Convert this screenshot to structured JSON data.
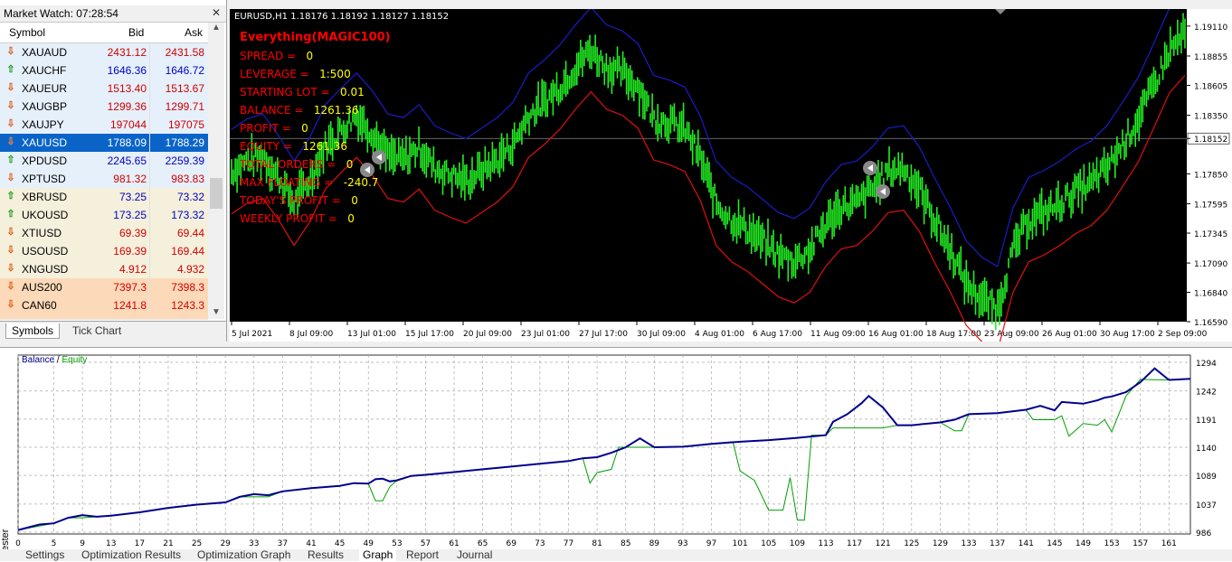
{
  "market_watch": {
    "title": "Market Watch: 07:28:54",
    "columns": {
      "symbol": "Symbol",
      "bid": "Bid",
      "ask": "Ask"
    },
    "rows": [
      {
        "symbol": "XAUAUD",
        "bid": "2431.12",
        "ask": "2431.58",
        "dir": "down",
        "color": "#d00000",
        "bg": "#e6f0fb"
      },
      {
        "symbol": "XAUCHF",
        "bid": "1646.36",
        "ask": "1646.72",
        "dir": "up",
        "color": "#0000c0",
        "bg": "#e6f0fb"
      },
      {
        "symbol": "XAUEUR",
        "bid": "1513.40",
        "ask": "1513.67",
        "dir": "down",
        "color": "#d00000",
        "bg": "#e6f0fb"
      },
      {
        "symbol": "XAUGBP",
        "bid": "1299.36",
        "ask": "1299.71",
        "dir": "down",
        "color": "#d00000",
        "bg": "#e6f0fb"
      },
      {
        "symbol": "XAUJPY",
        "bid": "197044",
        "ask": "197075",
        "dir": "down",
        "color": "#d00000",
        "bg": "#e6f0fb"
      },
      {
        "symbol": "XAUUSD",
        "bid": "1788.09",
        "ask": "1788.29",
        "dir": "down",
        "color": "#ffffff",
        "bg": "#0a64c8"
      },
      {
        "symbol": "XPDUSD",
        "bid": "2245.65",
        "ask": "2259.39",
        "dir": "up",
        "color": "#0000c0",
        "bg": "#e6f0fb"
      },
      {
        "symbol": "XPTUSD",
        "bid": "981.32",
        "ask": "983.83",
        "dir": "down",
        "color": "#d00000",
        "bg": "#e6f0fb"
      },
      {
        "symbol": "XBRUSD",
        "bid": "73.25",
        "ask": "73.32",
        "dir": "up",
        "color": "#0000c0",
        "bg": "#f5f0dc"
      },
      {
        "symbol": "UKOUSD",
        "bid": "173.25",
        "ask": "173.32",
        "dir": "up",
        "color": "#0000c0",
        "bg": "#f5f0dc"
      },
      {
        "symbol": "XTIUSD",
        "bid": "69.39",
        "ask": "69.44",
        "dir": "down",
        "color": "#d00000",
        "bg": "#f5f0dc"
      },
      {
        "symbol": "USOUSD",
        "bid": "169.39",
        "ask": "169.44",
        "dir": "down",
        "color": "#d00000",
        "bg": "#f5f0dc"
      },
      {
        "symbol": "XNGUSD",
        "bid": "4.912",
        "ask": "4.932",
        "dir": "down",
        "color": "#d00000",
        "bg": "#f5f0dc"
      },
      {
        "symbol": "AUS200",
        "bid": "7397.3",
        "ask": "7398.3",
        "dir": "down",
        "color": "#d00000",
        "bg": "#fcd9b8"
      },
      {
        "symbol": "CAN60",
        "bid": "1241.8",
        "ask": "1243.3",
        "dir": "down",
        "color": "#d00000",
        "bg": "#fcd9b8"
      }
    ],
    "tabs": [
      "Symbols",
      "Tick Chart"
    ]
  },
  "chart": {
    "header": "EURUSD,H1  1.18176 1.18192 1.18127 1.18152",
    "info_title": "Everything(MAGIC100)",
    "info": [
      {
        "label": "SPREAD =",
        "value": "0"
      },
      {
        "label": "LEVERAGE =",
        "value": "1:500"
      },
      {
        "label": "STARTING LOT =",
        "value": "0.01"
      },
      {
        "label": "BALANCE =",
        "value": "1261.36"
      },
      {
        "label": "PROFIT =",
        "value": "0"
      },
      {
        "label": "EQUITY =",
        "value": "1261.36"
      },
      {
        "label": "TOTAL ORDERS =",
        "value": "0"
      },
      {
        "label": "MAX FLOATING =",
        "value": "-240.7"
      },
      {
        "label": "TODAY'S PROFIT =",
        "value": "0"
      },
      {
        "label": "WEEKLY PROFIT =",
        "value": "0"
      }
    ],
    "price_axis": [
      "1.19110",
      "1.18855",
      "1.18605",
      "1.18350",
      "1.18152",
      "1.17850",
      "1.17595",
      "1.17345",
      "1.17090",
      "1.16840",
      "1.16590"
    ],
    "current_price": "1.18152",
    "time_axis": [
      "5 Jul 2021",
      "8 Jul 09:00",
      "13 Jul 01:00",
      "15 Jul 17:00",
      "20 Jul 09:00",
      "23 Jul 01:00",
      "27 Jul 17:00",
      "30 Jul 09:00",
      "4 Aug 01:00",
      "6 Aug 17:00",
      "11 Aug 09:00",
      "16 Aug 01:00",
      "18 Aug 17:00",
      "23 Aug 09:00",
      "26 Aug 01:00",
      "30 Aug 17:00",
      "2 Sep 09:00"
    ]
  },
  "tester": {
    "legend_balance": "Balance",
    "legend_sep": " / ",
    "legend_equity": "Equity",
    "y_axis": [
      "1294",
      "1242",
      "1191",
      "1140",
      "1089",
      "1037",
      "986"
    ],
    "x_axis": [
      "0",
      "5",
      "9",
      "13",
      "17",
      "21",
      "25",
      "29",
      "33",
      "37",
      "41",
      "45",
      "49",
      "53",
      "57",
      "61",
      "65",
      "69",
      "73",
      "77",
      "81",
      "85",
      "89",
      "93",
      "97",
      "101",
      "105",
      "109",
      "113",
      "117",
      "121",
      "125",
      "129",
      "133",
      "137",
      "141",
      "145",
      "149",
      "153",
      "157",
      "161"
    ],
    "side_label": "ester",
    "tabs": [
      "Settings",
      "Optimization Results",
      "Optimization Graph",
      "Results",
      "Graph",
      "Report",
      "Journal"
    ]
  },
  "chart_data": {
    "type": "line",
    "ylim": [
      986,
      1294
    ],
    "xlim": [
      0,
      164
    ],
    "series": [
      {
        "name": "Balance",
        "color": "#00008b",
        "points": [
          [
            0,
            990
          ],
          [
            3,
            1000
          ],
          [
            5,
            1002
          ],
          [
            7,
            1012
          ],
          [
            9,
            1017
          ],
          [
            11,
            1014
          ],
          [
            13,
            1016
          ],
          [
            17,
            1022
          ],
          [
            21,
            1030
          ],
          [
            25,
            1036
          ],
          [
            29,
            1040
          ],
          [
            31,
            1050
          ],
          [
            33,
            1055
          ],
          [
            35,
            1053
          ],
          [
            37,
            1060
          ],
          [
            41,
            1066
          ],
          [
            45,
            1070
          ],
          [
            47,
            1075
          ],
          [
            49,
            1074
          ],
          [
            50,
            1082
          ],
          [
            51,
            1083
          ],
          [
            52,
            1078
          ],
          [
            53,
            1080
          ],
          [
            55,
            1088
          ],
          [
            57,
            1090
          ],
          [
            61,
            1095
          ],
          [
            65,
            1100
          ],
          [
            69,
            1105
          ],
          [
            73,
            1110
          ],
          [
            77,
            1115
          ],
          [
            79,
            1120
          ],
          [
            81,
            1122
          ],
          [
            83,
            1130
          ],
          [
            85,
            1140
          ],
          [
            87,
            1156
          ],
          [
            89,
            1140
          ],
          [
            93,
            1141
          ],
          [
            97,
            1146
          ],
          [
            101,
            1150
          ],
          [
            105,
            1153
          ],
          [
            109,
            1157
          ],
          [
            113,
            1162
          ],
          [
            114,
            1186
          ],
          [
            116,
            1200
          ],
          [
            118,
            1220
          ],
          [
            119,
            1233
          ],
          [
            121,
            1212
          ],
          [
            123,
            1180
          ],
          [
            125,
            1180
          ],
          [
            129,
            1185
          ],
          [
            131,
            1190
          ],
          [
            133,
            1200
          ],
          [
            137,
            1202
          ],
          [
            141,
            1208
          ],
          [
            143,
            1215
          ],
          [
            145,
            1207
          ],
          [
            146,
            1222
          ],
          [
            149,
            1219
          ],
          [
            151,
            1225
          ],
          [
            152,
            1230
          ],
          [
            153,
            1232
          ],
          [
            155,
            1240
          ],
          [
            157,
            1258
          ],
          [
            159,
            1283
          ],
          [
            161,
            1262
          ],
          [
            164,
            1264
          ]
        ]
      },
      {
        "name": "Equity",
        "color": "#00a000",
        "points": [
          [
            0,
            990
          ],
          [
            5,
            1002
          ],
          [
            7,
            1012
          ],
          [
            9,
            1012
          ],
          [
            13,
            1016
          ],
          [
            17,
            1022
          ],
          [
            21,
            1030
          ],
          [
            25,
            1036
          ],
          [
            29,
            1040
          ],
          [
            31,
            1050
          ],
          [
            33,
            1050
          ],
          [
            35,
            1050
          ],
          [
            37,
            1060
          ],
          [
            41,
            1066
          ],
          [
            45,
            1070
          ],
          [
            47,
            1075
          ],
          [
            49,
            1074
          ],
          [
            50,
            1043
          ],
          [
            51,
            1043
          ],
          [
            52,
            1068
          ],
          [
            53,
            1080
          ],
          [
            55,
            1088
          ],
          [
            57,
            1090
          ],
          [
            61,
            1095
          ],
          [
            65,
            1100
          ],
          [
            69,
            1105
          ],
          [
            73,
            1110
          ],
          [
            77,
            1115
          ],
          [
            79,
            1120
          ],
          [
            80,
            1075
          ],
          [
            81,
            1094
          ],
          [
            83,
            1100
          ],
          [
            84,
            1140
          ],
          [
            87,
            1140
          ],
          [
            89,
            1140
          ],
          [
            93,
            1141
          ],
          [
            97,
            1146
          ],
          [
            100,
            1150
          ],
          [
            101,
            1097
          ],
          [
            103,
            1080
          ],
          [
            105,
            1026
          ],
          [
            107,
            1026
          ],
          [
            108,
            1085
          ],
          [
            109,
            1008
          ],
          [
            110,
            1008
          ],
          [
            111,
            1162
          ],
          [
            113,
            1162
          ],
          [
            114,
            1175
          ],
          [
            121,
            1175
          ],
          [
            123,
            1180
          ],
          [
            125,
            1180
          ],
          [
            129,
            1185
          ],
          [
            131,
            1170
          ],
          [
            132,
            1170
          ],
          [
            133,
            1200
          ],
          [
            137,
            1202
          ],
          [
            141,
            1208
          ],
          [
            142,
            1190
          ],
          [
            145,
            1190
          ],
          [
            146,
            1197
          ],
          [
            147,
            1160
          ],
          [
            149,
            1183
          ],
          [
            151,
            1180
          ],
          [
            152,
            1190
          ],
          [
            153,
            1168
          ],
          [
            155,
            1233
          ],
          [
            157,
            1263
          ],
          [
            161,
            1262
          ],
          [
            164,
            1264
          ]
        ]
      }
    ]
  },
  "price_data": {
    "ylim": [
      1.1659,
      1.1924
    ],
    "center": [
      1.1787,
      1.1796,
      1.18,
      1.1782,
      1.176,
      1.178,
      1.1808,
      1.1822,
      1.1835,
      1.182,
      1.18,
      1.1797,
      1.1808,
      1.179,
      1.1784,
      1.1779,
      1.1788,
      1.1797,
      1.181,
      1.1835,
      1.1846,
      1.1859,
      1.1876,
      1.1891,
      1.1876,
      1.1871,
      1.186,
      1.1833,
      1.1829,
      1.1823,
      1.1798,
      1.176,
      1.1746,
      1.1738,
      1.1727,
      1.1716,
      1.1711,
      1.172,
      1.1742,
      1.1757,
      1.176,
      1.1772,
      1.1788,
      1.179,
      1.1772,
      1.1745,
      1.172,
      1.1692,
      1.1678,
      1.167,
      1.172,
      1.1746,
      1.1752,
      1.176,
      1.177,
      1.1777,
      1.179,
      1.181,
      1.1831,
      1.186,
      1.189,
      1.1905
    ]
  }
}
